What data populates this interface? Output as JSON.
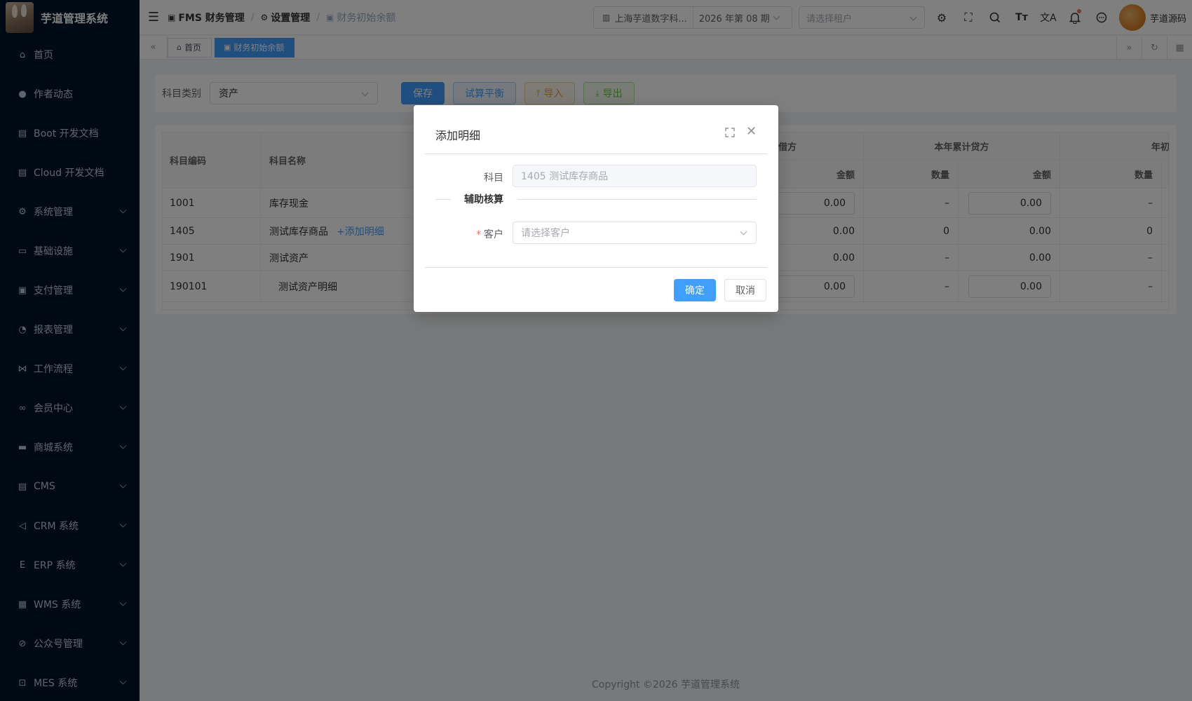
{
  "app": {
    "title": "芋道管理系统"
  },
  "sidebar": {
    "items": [
      {
        "label": "首页",
        "icon": "home-icon",
        "glyph": "⌂",
        "expandable": false
      },
      {
        "label": "作者动态",
        "icon": "user-icon",
        "glyph": "●",
        "expandable": false
      },
      {
        "label": "Boot 开发文档",
        "icon": "document-icon",
        "glyph": "▤",
        "expandable": false
      },
      {
        "label": "Cloud 开发文档",
        "icon": "document-icon",
        "glyph": "▤",
        "expandable": false
      },
      {
        "label": "系统管理",
        "icon": "gear-icon",
        "glyph": "⚙",
        "expandable": true
      },
      {
        "label": "基础设施",
        "icon": "monitor-icon",
        "glyph": "▭",
        "expandable": true
      },
      {
        "label": "支付管理",
        "icon": "wallet-icon",
        "glyph": "▣",
        "expandable": true
      },
      {
        "label": "报表管理",
        "icon": "pie-chart-icon",
        "glyph": "◔",
        "expandable": true
      },
      {
        "label": "工作流程",
        "icon": "flow-icon",
        "glyph": "⋈",
        "expandable": true
      },
      {
        "label": "会员中心",
        "icon": "bike-icon",
        "glyph": "∞",
        "expandable": true
      },
      {
        "label": "商城系统",
        "icon": "shop-icon",
        "glyph": "▬",
        "expandable": true
      },
      {
        "label": "CMS",
        "icon": "document-icon",
        "glyph": "▤",
        "expandable": true
      },
      {
        "label": "CRM 系统",
        "icon": "send-icon",
        "glyph": "◁",
        "expandable": true
      },
      {
        "label": "ERP 系统",
        "icon": "erp-icon",
        "glyph": "E",
        "expandable": true
      },
      {
        "label": "WMS 系统",
        "icon": "package-icon",
        "glyph": "▦",
        "expandable": true
      },
      {
        "label": "公众号管理",
        "icon": "compass-icon",
        "glyph": "⊘",
        "expandable": true
      },
      {
        "label": "MES 系统",
        "icon": "chip-icon",
        "glyph": "⊡",
        "expandable": true
      }
    ]
  },
  "header": {
    "breadcrumb": [
      "FMS 财务管理",
      "设置管理",
      "财务初始余额"
    ],
    "org": "上海芋道数字科...",
    "period": "2026 年第 08 期",
    "tenant_placeholder": "请选择租户",
    "username": "芋道源码"
  },
  "tags": {
    "items": [
      {
        "label": "首页",
        "active": false
      },
      {
        "label": "财务初始余额",
        "active": true
      }
    ]
  },
  "toolbar": {
    "category_label": "科目类别",
    "category_value": "资产",
    "save": "保存",
    "trial_balance": "试算平衡",
    "import": "导入",
    "export": "导出"
  },
  "table": {
    "headers": {
      "code": "科目编码",
      "name": "科目名称",
      "debit_group": "借方",
      "credit_group": "本年累计贷方",
      "year_group": "年初",
      "amount": "金额",
      "quantity": "数量"
    },
    "rows": [
      {
        "code": "1001",
        "name": "库存现金",
        "add_link": "",
        "debit_amount": "0.00",
        "debit_editable": true,
        "credit_qty": "–",
        "credit_amount": "0.00",
        "credit_editable": true,
        "year_qty": "–"
      },
      {
        "code": "1405",
        "name": "测试库存商品",
        "add_link": "+添加明细",
        "debit_amount": "0.00",
        "debit_editable": false,
        "credit_qty": "0",
        "credit_amount": "0.00",
        "credit_editable": false,
        "year_qty": "0"
      },
      {
        "code": "1901",
        "name": "测试资产",
        "add_link": "",
        "debit_amount": "0.00",
        "debit_editable": false,
        "credit_qty": "–",
        "credit_amount": "0.00",
        "credit_editable": false,
        "year_qty": "–"
      },
      {
        "code": "190101",
        "name": "测试资产明细",
        "add_link": "",
        "debit_amount": "0.00",
        "debit_editable": true,
        "credit_qty": "–",
        "credit_amount": "0.00",
        "credit_editable": true,
        "year_qty": "–"
      }
    ]
  },
  "footer": {
    "copyright": "Copyright ©2026 芋道管理系统"
  },
  "dialog": {
    "title": "添加明细",
    "subject_label": "科目",
    "subject_value": "1405 测试库存商品",
    "aux_title": "辅助核算",
    "customer_label": "客户",
    "customer_placeholder": "请选择客户",
    "ok": "确定",
    "cancel": "取消"
  },
  "colors": {
    "primary": "#409eff",
    "sidebar_bg": "#001529",
    "danger": "#f56c6c",
    "warning": "#e6a23c",
    "success": "#67c23a"
  }
}
